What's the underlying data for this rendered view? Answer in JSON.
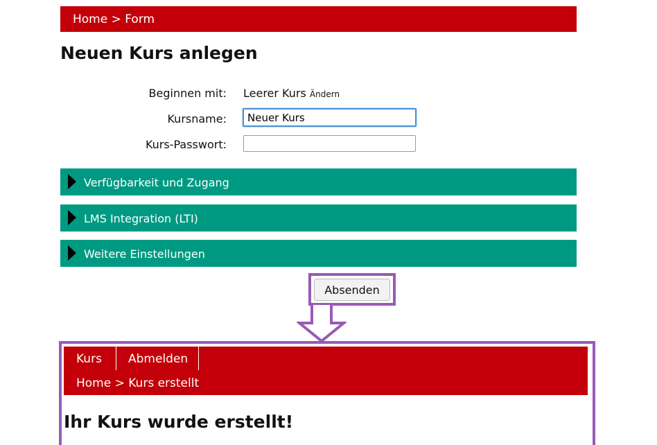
{
  "breadcrumb_top": "Home > Form",
  "page_title": "Neuen Kurs anlegen",
  "form": {
    "start_label": "Beginnen mit:",
    "start_value": "Leerer Kurs",
    "start_change": "Ändern",
    "name_label": "Kursname:",
    "name_value": "Neuer Kurs",
    "password_label": "Kurs-Passwort:",
    "password_value": ""
  },
  "sections": [
    {
      "label": "Verfügbarkeit und Zugang"
    },
    {
      "label": "LMS Integration (LTI)"
    },
    {
      "label": "Weitere Einstellungen"
    }
  ],
  "submit_label": "Absenden",
  "result": {
    "tabs": [
      {
        "label": "Kurs"
      },
      {
        "label": "Abmelden"
      }
    ],
    "breadcrumb": "Home > Kurs erstellt",
    "title": "Ihr Kurs wurde erstellt!"
  },
  "colors": {
    "header_red": "#c30009",
    "section_teal": "#009a82",
    "highlight_purple": "#9b59b6"
  }
}
